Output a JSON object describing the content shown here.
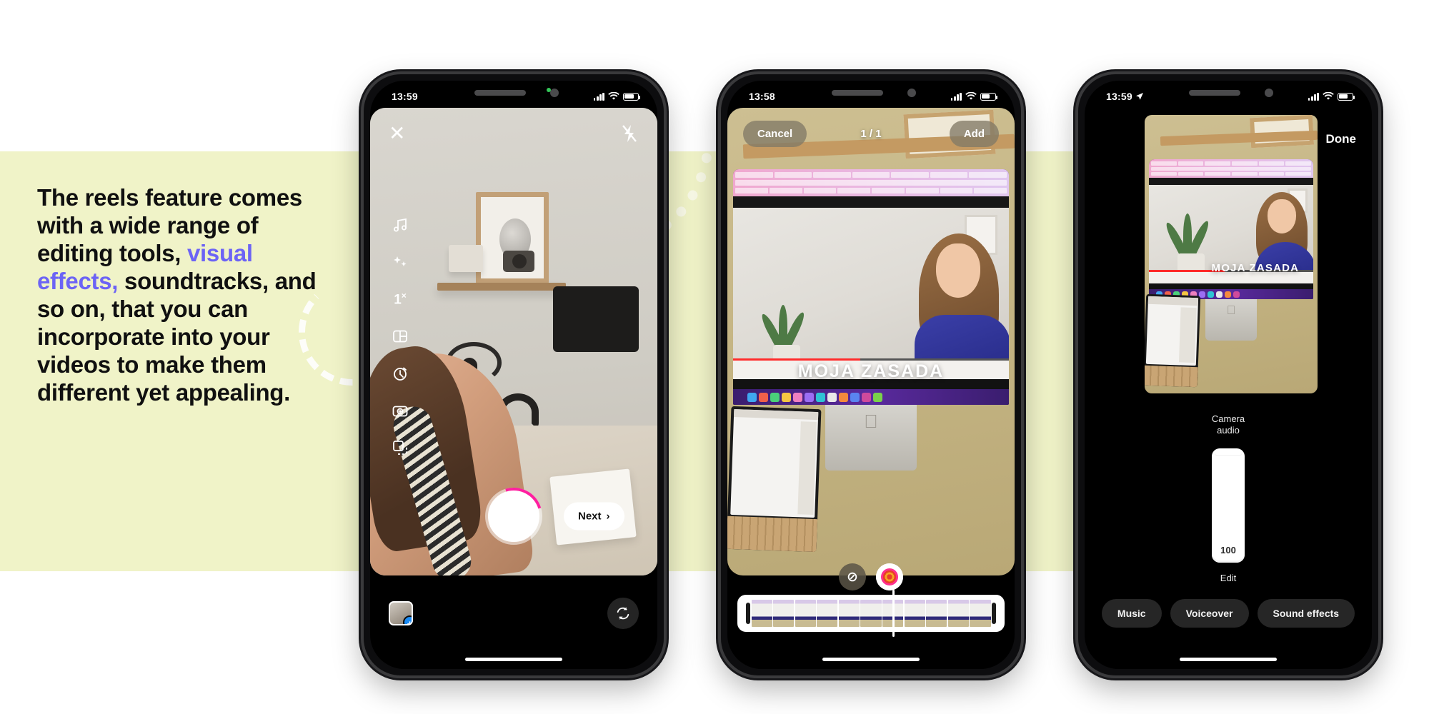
{
  "marketing": {
    "text_part1": "The reels feature comes with a wide range of editing tools, ",
    "accent": "visual effects,",
    "text_part2": " soundtracks, and so on, that you can incorporate into your videos to make them different yet appealing.",
    "accent_color": "#6c63f5",
    "band_color": "#f0f3c8"
  },
  "phone1": {
    "status": {
      "time": "13:59",
      "signal": "signal-bars",
      "wifi": "wifi-icon",
      "battery": "battery-icon"
    },
    "close_icon": "✕",
    "flash_icon": "⚡",
    "tools": [
      {
        "name": "music",
        "glyph": "♫"
      },
      {
        "name": "effects",
        "glyph": "✦"
      },
      {
        "name": "speed",
        "glyph": "1",
        "sup": "×"
      },
      {
        "name": "layout",
        "glyph": "▣"
      },
      {
        "name": "timer",
        "glyph": "⏱"
      },
      {
        "name": "gestures",
        "glyph": "◎"
      },
      {
        "name": "align",
        "glyph": "▧"
      }
    ],
    "next_label": "Next",
    "next_chevron": "›",
    "gallery_plus": "+",
    "flip_icon": "↻"
  },
  "phone2": {
    "status": {
      "time": "13:58"
    },
    "cancel_label": "Cancel",
    "counter": "1 / 1",
    "add_label": "Add",
    "overlay_text": "MOJA ZASADA",
    "mute_icon": "⊘",
    "effects_icon": "target-icon",
    "timeline_frames": 11
  },
  "phone3": {
    "status": {
      "time": "13:59",
      "location_arrow": "➤"
    },
    "done_label": "Done",
    "mixer_label": "Camera\naudio",
    "mixer_label_line1": "Camera",
    "mixer_label_line2": "audio",
    "volume_value": "100",
    "edit_label": "Edit",
    "actions": [
      {
        "label": "Music"
      },
      {
        "label": "Voiceover"
      },
      {
        "label": "Sound effects"
      }
    ]
  }
}
